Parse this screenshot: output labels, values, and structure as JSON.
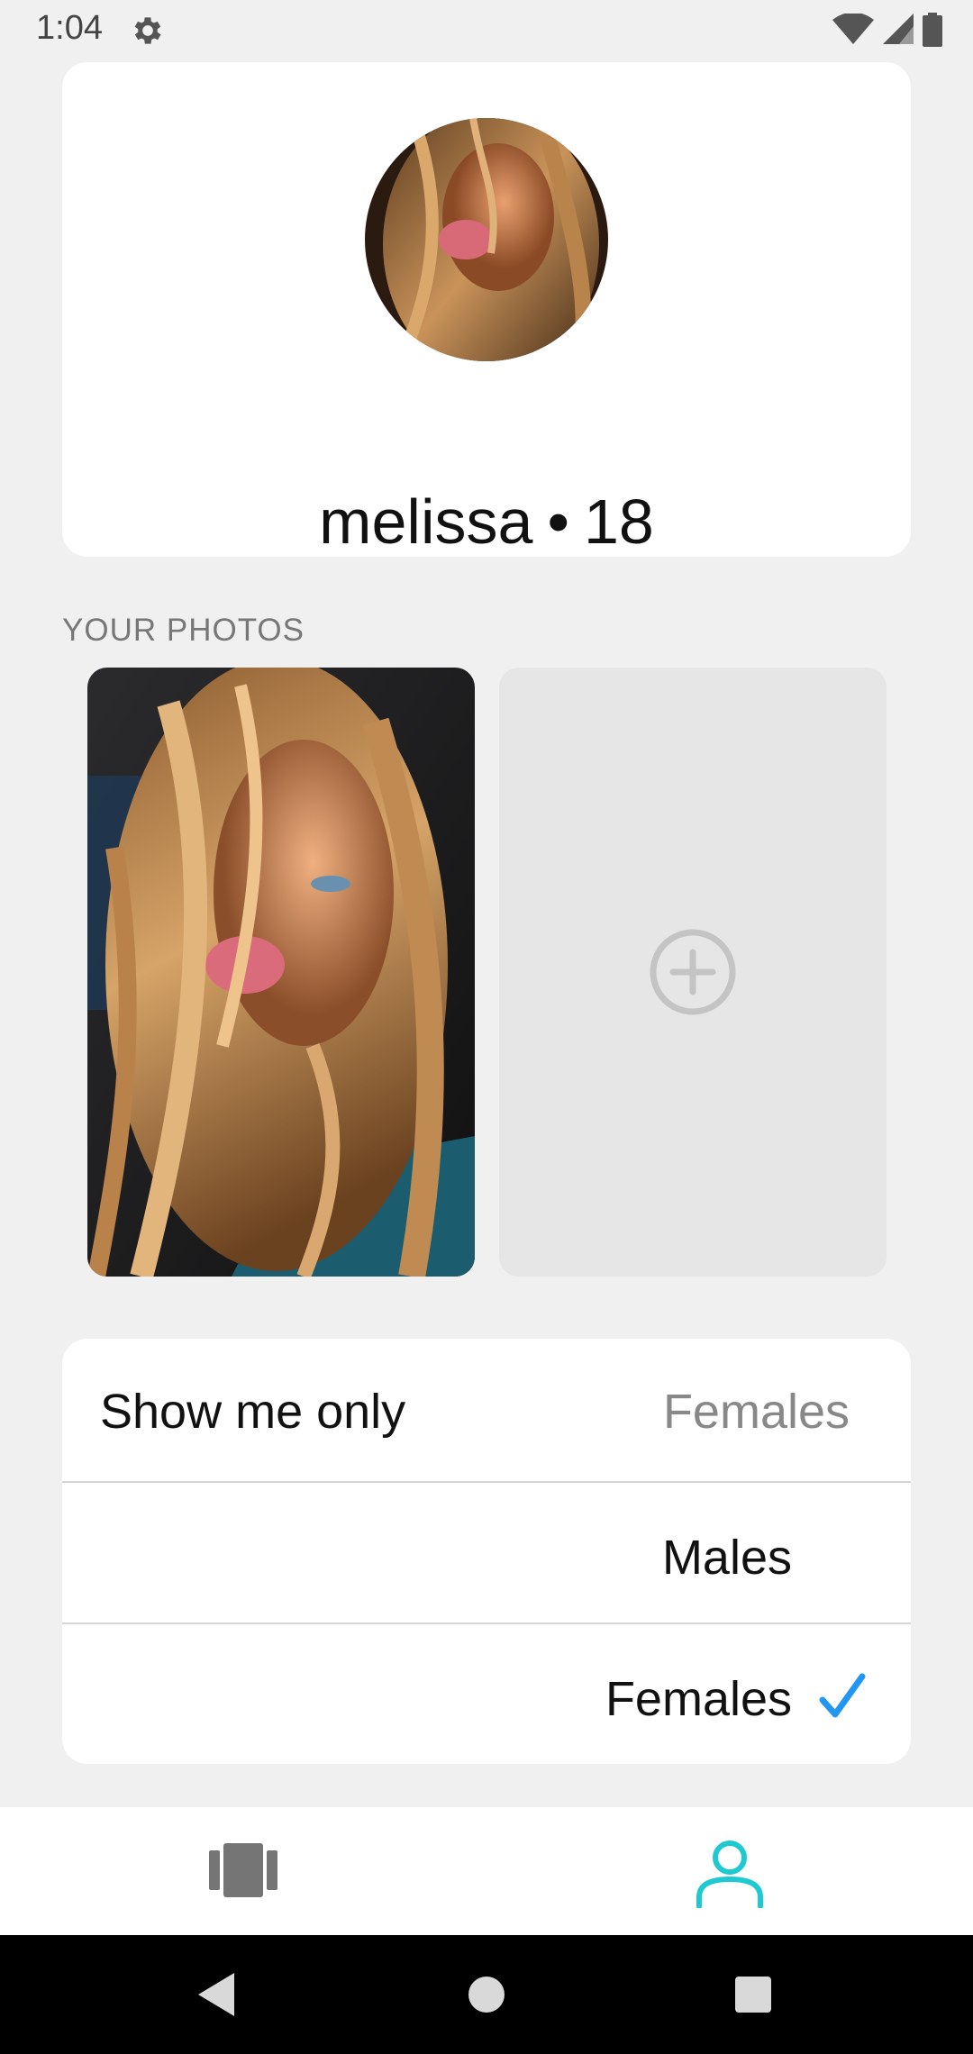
{
  "status_bar": {
    "time": "1:04"
  },
  "profile": {
    "name": "melissa",
    "separator": "•",
    "age": "18"
  },
  "photos": {
    "section_label": "YOUR PHOTOS"
  },
  "filter": {
    "title": "Show me only",
    "current_value": "Females",
    "options": [
      {
        "label": "Males",
        "selected": false
      },
      {
        "label": "Females",
        "selected": true
      }
    ]
  },
  "colors": {
    "accent": "#1ec9d1",
    "check": "#2196f3",
    "nav_inactive": "#757575"
  },
  "icons": {
    "add_photo": "plus-circle-icon",
    "nav_left": "cards-stack-icon",
    "nav_right": "person-icon"
  }
}
